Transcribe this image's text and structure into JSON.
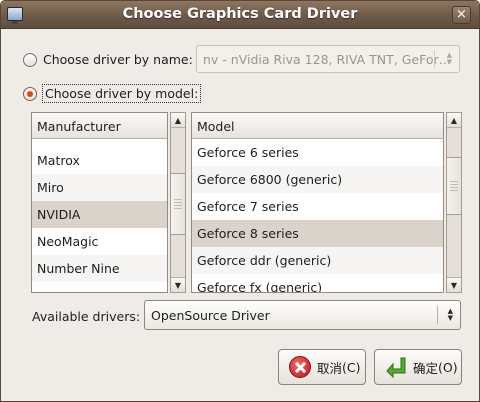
{
  "window": {
    "title": "Choose Graphics Card Driver",
    "close_glyph": "×",
    "icon": "monitor-icon"
  },
  "by_name": {
    "label": "Choose driver by name:",
    "selected": false,
    "value": "nv - nVidia Riva 128, RIVA TNT, GeFor…"
  },
  "by_model": {
    "label": "Choose driver by model:",
    "selected": true
  },
  "manufacturer_list": {
    "header": "Manufacturer",
    "items": [
      {
        "label": "Matrox",
        "selected": false
      },
      {
        "label": "Miro",
        "selected": false
      },
      {
        "label": "NVIDIA",
        "selected": true
      },
      {
        "label": "NeoMagic",
        "selected": false
      },
      {
        "label": "Number Nine",
        "selected": false
      }
    ]
  },
  "model_list": {
    "header": "Model",
    "items": [
      {
        "label": "Geforce 6 series",
        "selected": false
      },
      {
        "label": "Geforce 6800 (generic)",
        "selected": false
      },
      {
        "label": "Geforce 7 series",
        "selected": false
      },
      {
        "label": "Geforce 8 series",
        "selected": true
      },
      {
        "label": "Geforce ddr (generic)",
        "selected": false
      },
      {
        "label": "Geforce fx (generic)",
        "selected": false
      }
    ]
  },
  "available_drivers": {
    "label": "Available drivers:",
    "value": "OpenSource Driver"
  },
  "buttons": {
    "cancel_label": "取消",
    "cancel_mnemonic": "(C)",
    "ok_label": "确定",
    "ok_mnemonic": "(O)"
  },
  "colors": {
    "titlebar": "#6e5a49",
    "selection": "#d9d3cb",
    "radio_accent": "#d9481a",
    "ok_arrow": "#5aa832"
  }
}
